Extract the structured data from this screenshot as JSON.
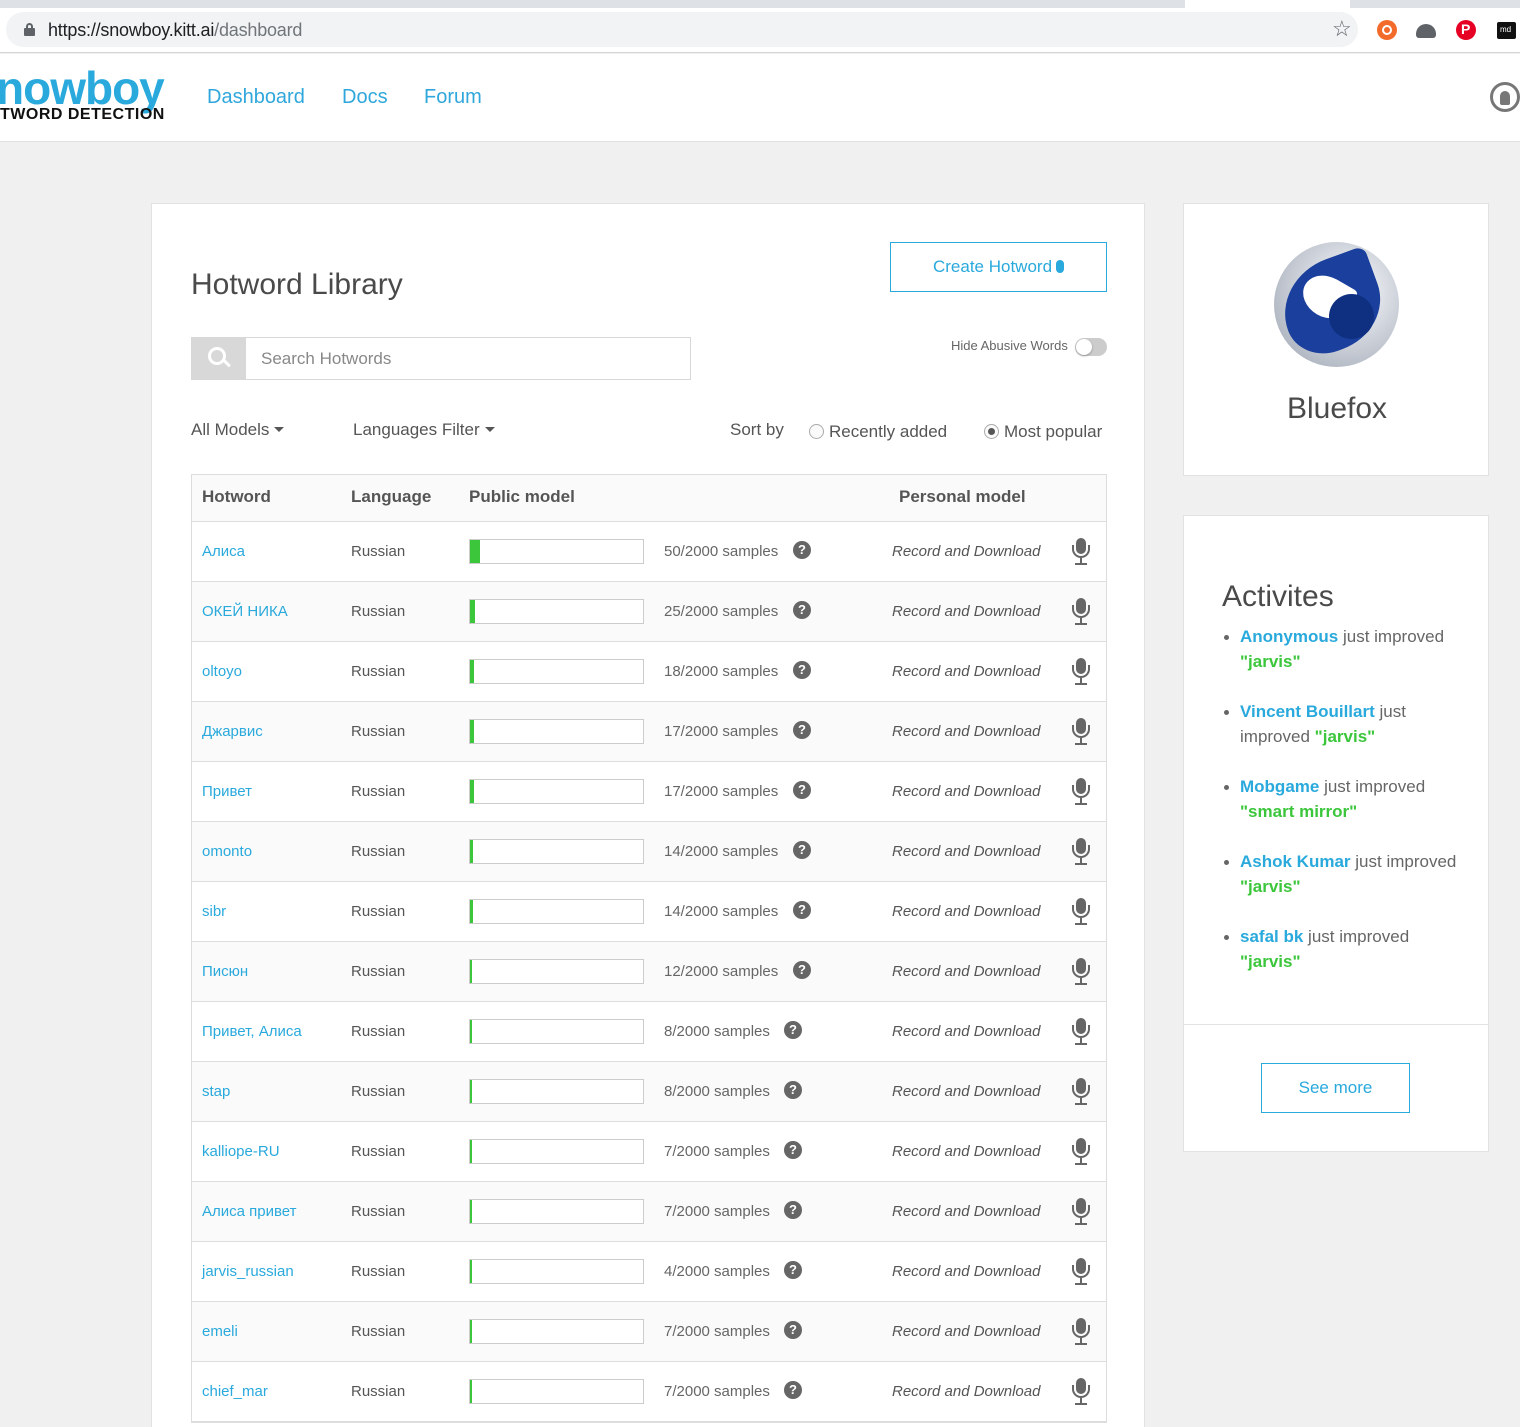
{
  "browser": {
    "url_host": "https://snowboy.kitt.ai",
    "url_path": "/dashboard"
  },
  "header": {
    "logo_main": "nowboy",
    "logo_sub": "TWORD DETECTION",
    "nav": [
      "Dashboard",
      "Docs",
      "Forum"
    ]
  },
  "library": {
    "title": "Hotword Library",
    "create_button": "Create Hotword",
    "search_placeholder": "Search Hotwords",
    "hide_abusive_label": "Hide Abusive Words",
    "hide_abusive_on": false,
    "filters": {
      "models": "All Models",
      "languages": "Languages Filter",
      "sort_label": "Sort by",
      "sort_options": [
        "Recently added",
        "Most popular"
      ],
      "sort_selected": "Most popular"
    },
    "columns": [
      "Hotword",
      "Language",
      "Public model",
      "Personal model"
    ],
    "rows": [
      {
        "word": "Алиса",
        "lang": "Russian",
        "samples": "50/2000 samples",
        "progress": 0.025,
        "record": "Record and Download"
      },
      {
        "word": "ОКЕЙ НИКА",
        "lang": "Russian",
        "samples": "25/2000 samples",
        "progress": 0.0125,
        "record": "Record and Download"
      },
      {
        "word": "oltoyo",
        "lang": "Russian",
        "samples": "18/2000 samples",
        "progress": 0.009,
        "record": "Record and Download"
      },
      {
        "word": "Джарвис",
        "lang": "Russian",
        "samples": "17/2000 samples",
        "progress": 0.0085,
        "record": "Record and Download"
      },
      {
        "word": "Привет",
        "lang": "Russian",
        "samples": "17/2000 samples",
        "progress": 0.0085,
        "record": "Record and Download"
      },
      {
        "word": "omonto",
        "lang": "Russian",
        "samples": "14/2000 samples",
        "progress": 0.007,
        "record": "Record and Download"
      },
      {
        "word": "sibr",
        "lang": "Russian",
        "samples": "14/2000 samples",
        "progress": 0.007,
        "record": "Record and Download"
      },
      {
        "word": "Писюн",
        "lang": "Russian",
        "samples": "12/2000 samples",
        "progress": 0.006,
        "record": "Record and Download"
      },
      {
        "word": "Привет, Алиса",
        "lang": "Russian",
        "samples": "8/2000 samples",
        "progress": 0.004,
        "record": "Record and Download"
      },
      {
        "word": "stap",
        "lang": "Russian",
        "samples": "8/2000 samples",
        "progress": 0.004,
        "record": "Record and Download"
      },
      {
        "word": "kalliope-RU",
        "lang": "Russian",
        "samples": "7/2000 samples",
        "progress": 0.0035,
        "record": "Record and Download"
      },
      {
        "word": "Алиса привет",
        "lang": "Russian",
        "samples": "7/2000 samples",
        "progress": 0.0035,
        "record": "Record and Download"
      },
      {
        "word": "jarvis_russian",
        "lang": "Russian",
        "samples": "4/2000 samples",
        "progress": 0.002,
        "record": "Record and Download"
      },
      {
        "word": "emeli",
        "lang": "Russian",
        "samples": "7/2000 samples",
        "progress": 0.0035,
        "record": "Record and Download"
      },
      {
        "word": "chief_mar",
        "lang": "Russian",
        "samples": "7/2000 samples",
        "progress": 0.0035,
        "record": "Record and Download"
      }
    ]
  },
  "profile": {
    "name": "Bluefox"
  },
  "activities": {
    "title": "Activites",
    "items": [
      {
        "user": "Anonymous",
        "action": "just improved",
        "word": "\"jarvis\""
      },
      {
        "user": "Vincent Bouillart",
        "action": "just improved",
        "word": "\"jarvis\""
      },
      {
        "user": "Mobgame",
        "action": "just improved",
        "word": "\"smart mirror\""
      },
      {
        "user": "Ashok Kumar",
        "action": "just improved",
        "word": "\"jarvis\""
      },
      {
        "user": "safal bk",
        "action": "just improved",
        "word": "\"jarvis\""
      }
    ],
    "see_more": "See more"
  },
  "colors": {
    "accent": "#29a9dc",
    "progress": "#3cc63c"
  }
}
